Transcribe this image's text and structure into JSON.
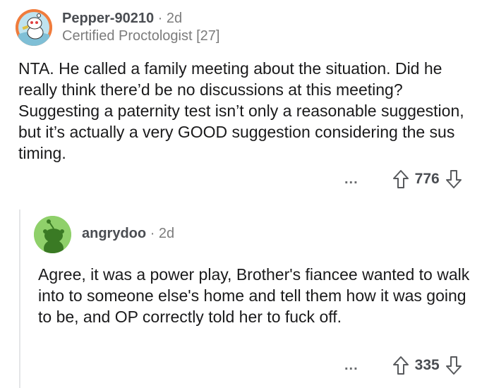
{
  "comments": [
    {
      "username": "Pepper-90210",
      "time": "2d",
      "flair": "Certified Proctologist [27]",
      "body": "NTA. He called a family meeting about the situation. Did he really think there’d be no discussions at this meeting? Suggesting a paternity test isn’t only a reasonable suggestion, but it’s actually a very GOOD suggestion considering the sus timing.",
      "more": "...",
      "votes": "776",
      "avatar_bg": "#f07c3c"
    },
    {
      "username": "angrydoo",
      "time": "2d",
      "body": "Agree, it was a power play, Brother's fiancee wanted to walk into to someone else's home and tell them how it was going to be, and OP correctly told her to fuck off.",
      "more": "...",
      "votes": "335",
      "avatar_bg": "#8fd06a"
    }
  ],
  "separator": "·",
  "icons": {
    "upvote": "arrow-up-icon",
    "downvote": "arrow-down-icon",
    "more": "more-icon"
  },
  "colors": {
    "text": "#1a1a1b",
    "meta": "#7c7c7c",
    "thread_line": "#e4e5e7"
  }
}
